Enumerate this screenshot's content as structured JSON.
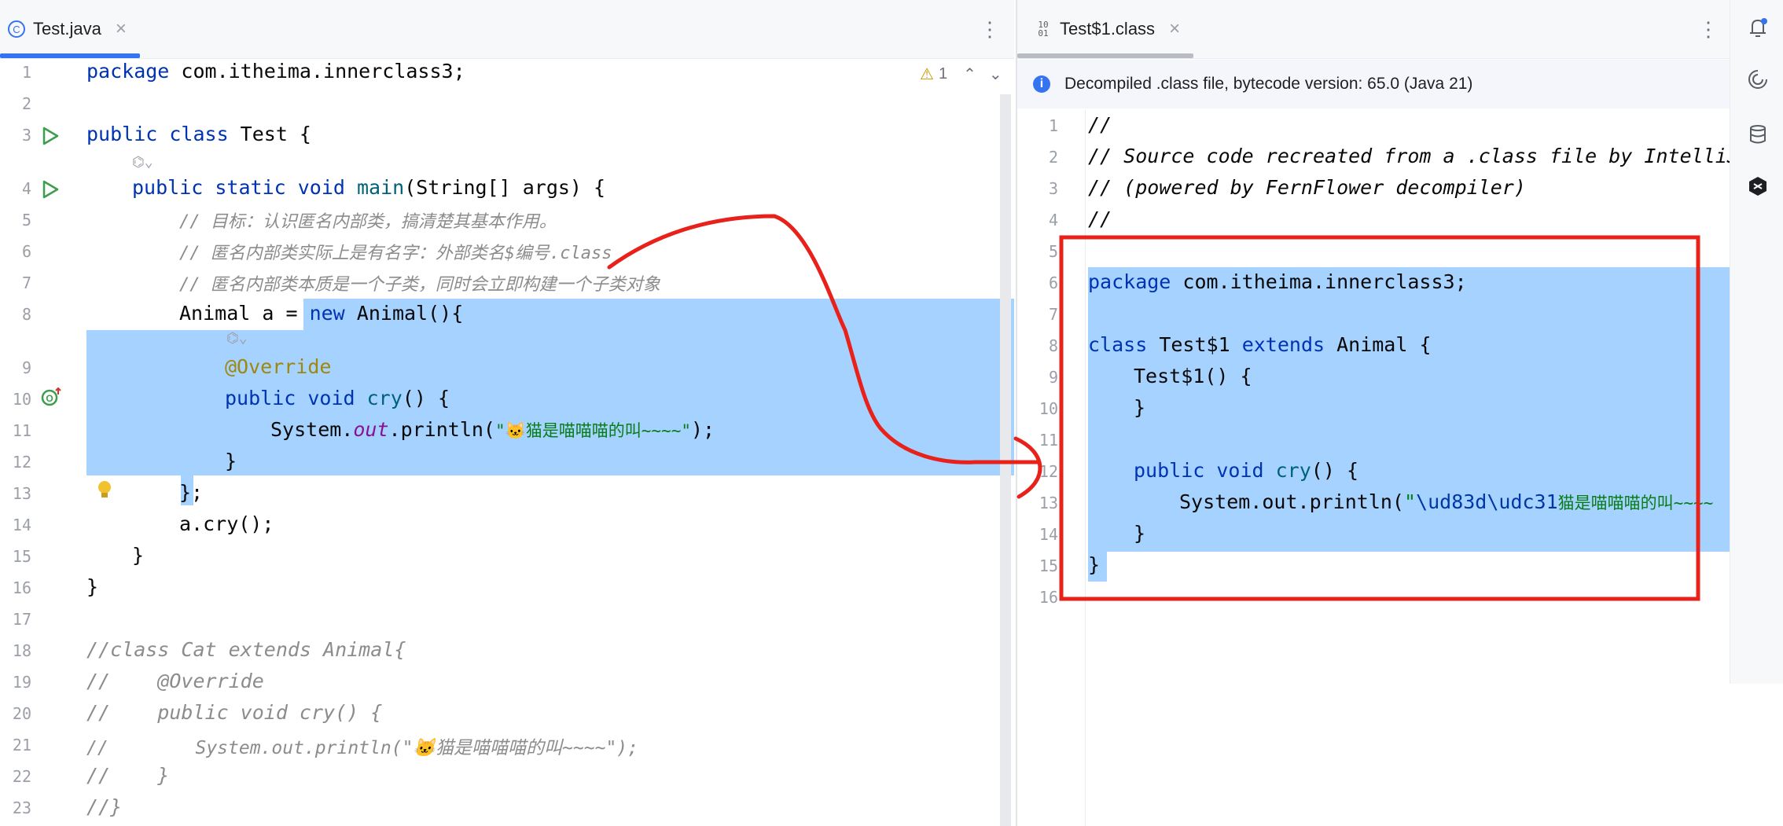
{
  "left_editor": {
    "tab_label": "Test.java",
    "tab_close": "×",
    "kebab": "⋮",
    "warning_count": "1",
    "lines": [
      "1",
      "2",
      "3",
      "4",
      "5",
      "6",
      "7",
      "8",
      "9",
      "10",
      "11",
      "12",
      "13",
      "14",
      "15",
      "16",
      "17",
      "18",
      "19",
      "20",
      "21",
      "22",
      "23"
    ],
    "code": {
      "l1_kw": "package",
      "l1_rest": " com.itheima.innerclass3;",
      "l3_kw": "public class",
      "l3_rest": " Test {",
      "l4_kw1": "public static void",
      "l4_fn": " main",
      "l4_rest": "(String[] args) {",
      "l5": "// 目标：认识匿名内部类，搞清楚其基本作用。",
      "l6": "// 匿名内部类实际上是有名字：外部类名$编号.class",
      "l7": "// 匿名内部类本质是一个子类，同时会立即构建一个子类对象",
      "l8_a": "Animal a = ",
      "l8_kw": "new",
      "l8_b": " Animal(){",
      "l9": "@Override",
      "l10_kw": "public void",
      "l10_fn": " cry",
      "l10_rest": "() {",
      "l11_a": "System.",
      "l11_fld": "out",
      "l11_b": ".println(",
      "l11_str": "\"🐱猫是喵喵喵的叫~~~~\"",
      "l11_c": ");",
      "l12": "}",
      "l13": "};",
      "l14": "a.cry();",
      "l15": "}",
      "l16": "}",
      "l18": "//class Cat extends Animal{",
      "l19": "//    @Override",
      "l20": "//    public void cry() {",
      "l21": "//        System.out.println(\"🐱猫是喵喵喵的叫~~~~\");",
      "l22": "//    }",
      "l23": "//}"
    }
  },
  "right_editor": {
    "tab_label": "Test$1.class",
    "tab_close": "×",
    "kebab": "⋮",
    "banner_text": "Decompiled .class file, bytecode version: 65.0 (Java 21)",
    "lines": [
      "1",
      "2",
      "3",
      "4",
      "5",
      "6",
      "7",
      "8",
      "9",
      "10",
      "11",
      "12",
      "13",
      "14",
      "15",
      "16"
    ],
    "code": {
      "r1": "//",
      "r2": "// Source code recreated from a .class file by IntelliJ",
      "r3": "// (powered by FernFlower decompiler)",
      "r4": "//",
      "r6_kw": "package",
      "r6_rest": " com.itheima.innerclass3;",
      "r8_kw1": "class",
      "r8_a": " Test$1 ",
      "r8_kw2": "extends",
      "r8_b": " Animal {",
      "r9": "Test$1() {",
      "r10": "}",
      "r12_kw": "public void",
      "r12_fn": " cry",
      "r12_rest": "() {",
      "r13_a": "System.out.println(",
      "r13_q": "\"",
      "r13_esc": "\\ud83d\\udc31",
      "r13_str": "猫是喵喵喵的叫~~~~",
      "r14": "}",
      "r15": "}"
    }
  },
  "colors": {
    "selection": "#a6d2ff",
    "annotation_red": "#e8211a",
    "accent_blue": "#3574f0"
  }
}
